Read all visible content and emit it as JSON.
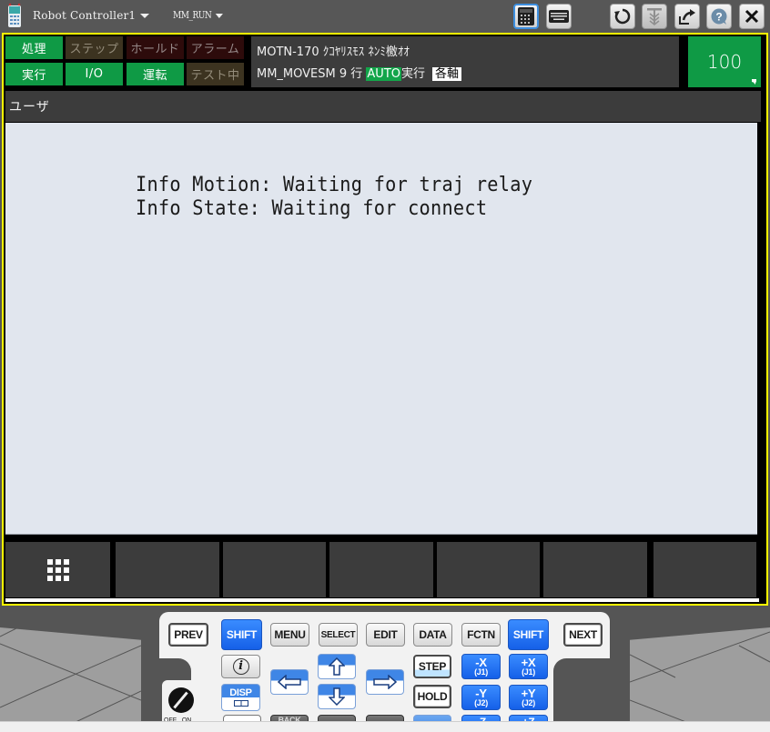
{
  "titlebar": {
    "controller_dropdown": "Robot Controller1",
    "program_dropdown": "MM_RUN",
    "buttons": [
      {
        "name": "teach-pendant-view-icon",
        "active": true
      },
      {
        "name": "keyboard-icon",
        "active": false
      },
      {
        "name": "refresh-icon",
        "active": false
      },
      {
        "name": "pin-disabled-icon",
        "active": false
      },
      {
        "name": "external-window-icon",
        "active": false
      },
      {
        "name": "help-icon",
        "active": false
      },
      {
        "name": "close-icon",
        "active": false
      }
    ]
  },
  "status": {
    "row1": [
      {
        "label": "処理",
        "state": "on"
      },
      {
        "label": "ステップ",
        "state": "off"
      },
      {
        "label": "ホールド",
        "state": "off-alarm"
      },
      {
        "label": "アラーム",
        "state": "off-alarm"
      }
    ],
    "row2": [
      {
        "label": "実行",
        "state": "on"
      },
      {
        "label": "I/O",
        "state": "on"
      },
      {
        "label": "運転",
        "state": "on"
      },
      {
        "label": "テスト中",
        "state": "off"
      }
    ]
  },
  "info": {
    "line1": "MOTN-170 ｸｺﾔﾘｽﾓｽ ﾈﾝﾐ檄ｵｵ",
    "line2_program": "MM_MOVESM 9 行 ",
    "line2_mode": "AUTO",
    "line2_state": "実行",
    "line2_coord": "各軸"
  },
  "override": {
    "value": "100"
  },
  "screen": {
    "title": "ユーザ",
    "messages": [
      "Info Motion: Waiting for traj relay",
      "Info State: Waiting for connect"
    ]
  },
  "fkeys": {
    "menu_icon": "grid-menu-icon",
    "labels": [
      "",
      "",
      "",
      "",
      "",
      ""
    ]
  },
  "keypad": {
    "prev": "PREV",
    "shift_left": "SHIFT",
    "menu": "MENU",
    "select": "SELECT",
    "edit": "EDIT",
    "data": "DATA",
    "fctn": "FCTN",
    "shift_right": "SHIFT",
    "next": "NEXT",
    "info": "i",
    "disp": "DISP",
    "step": "STEP",
    "hold": "HOLD",
    "back": "BACK",
    "minus_x": "-X",
    "minus_x_sub": "(J1)",
    "plus_x": "+X",
    "plus_x_sub": "(J1)",
    "minus_y": "-Y",
    "minus_y_sub": "(J2)",
    "plus_y": "+Y",
    "plus_y_sub": "(J2)",
    "minus_z": "-Z",
    "plus_z": "+Z",
    "switch_off": "OFF",
    "switch_on": "ON"
  },
  "colors": {
    "frame_highlight": "#ffff00",
    "status_on": "#0f9a45",
    "key_blue": "#1f6ef0"
  }
}
